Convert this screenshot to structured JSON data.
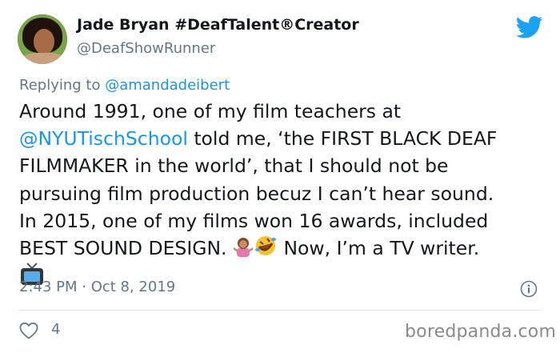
{
  "author": {
    "display_name": "Jade Bryan #DeafTalent®Creator",
    "handle": "@DeafShowRunner"
  },
  "reply": {
    "prefix": "Replying to ",
    "mention": "@amandadeibert"
  },
  "tweet": {
    "line1": "Around 1991, one of my film teachers at",
    "line2_link": "@NYUTischSchool",
    "line2_rest": " told me, ‘the FIRST BLACK DEAF",
    "line3": "FILMMAKER in the world’, that I should not be",
    "line4": "pursuing film production becuz I can’t hear sound.",
    "line5": "In 2015, one of my films won 16 awards, included",
    "line6_a": "BEST SOUND DESIGN. ",
    "line6_b": " Now, I’m a TV writer.",
    "emojis": [
      "person-shrugging-icon",
      "rolling-on-floor-laughing-icon",
      "television-icon"
    ]
  },
  "meta": {
    "timestamp": "2:43 PM · Oct 8, 2019"
  },
  "stats": {
    "likes": "4"
  },
  "watermark": "boredpanda.com",
  "colors": {
    "twitter_blue": "#1da1f2",
    "link": "#1b95e0",
    "secondary_text": "#657786",
    "divider": "#e1e8ed"
  }
}
